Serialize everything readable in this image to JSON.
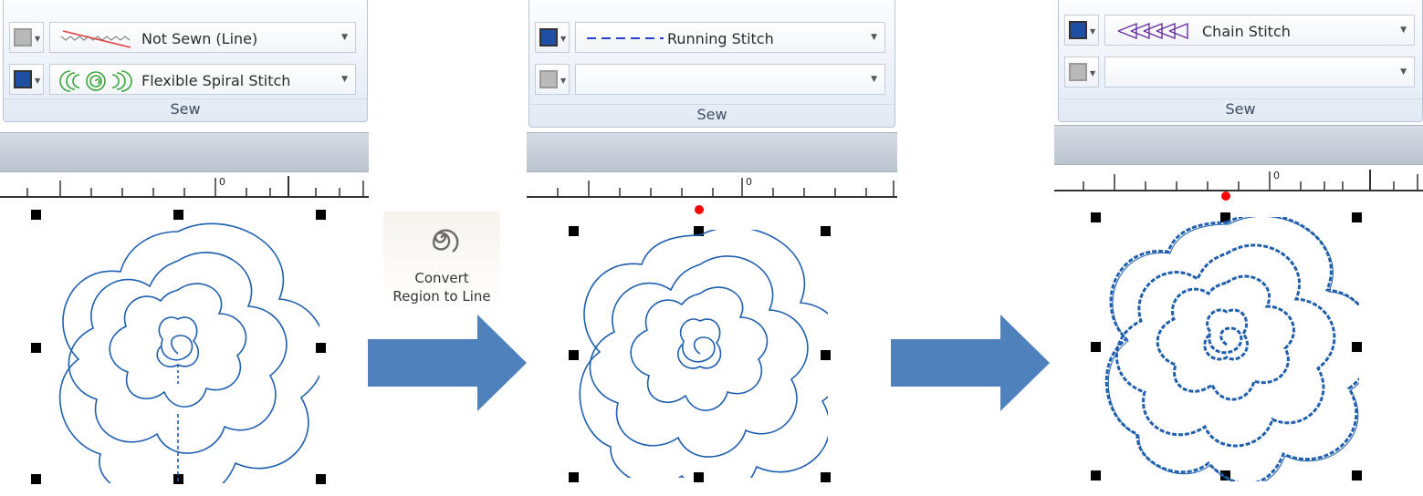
{
  "panels": [
    {
      "group_caption": "Sew",
      "outline_type": "Not Sewn (Line)",
      "region_type": "Flexible Spiral Stitch",
      "ruler_zero": "0"
    },
    {
      "group_caption": "Sew",
      "outline_type": "Running Stitch",
      "region_type": "",
      "ruler_zero": "0"
    },
    {
      "group_caption": "Sew",
      "outline_type": "Chain Stitch",
      "region_type": "",
      "ruler_zero": "0"
    }
  ],
  "convert_button": {
    "line1": "Convert",
    "line2": "Region to Line",
    "icon": "spiral-icon"
  },
  "colors": {
    "stitch_blue": "#1f5fae",
    "thread_swatch": "#1f4fa3",
    "spiral_green": "#3aa63a",
    "running_dash": "#2b3fd8",
    "chain_purple": "#6b2fa0",
    "arrow_fill": "#4f81bd",
    "start_point": "#ff0000"
  },
  "icons": [
    "color-button-swatch",
    "dropdown-arrow-icon",
    "not-sewn-line-icon",
    "spiral-stitch-icon",
    "running-stitch-icon",
    "chain-stitch-icon",
    "right-arrow-icon"
  ]
}
